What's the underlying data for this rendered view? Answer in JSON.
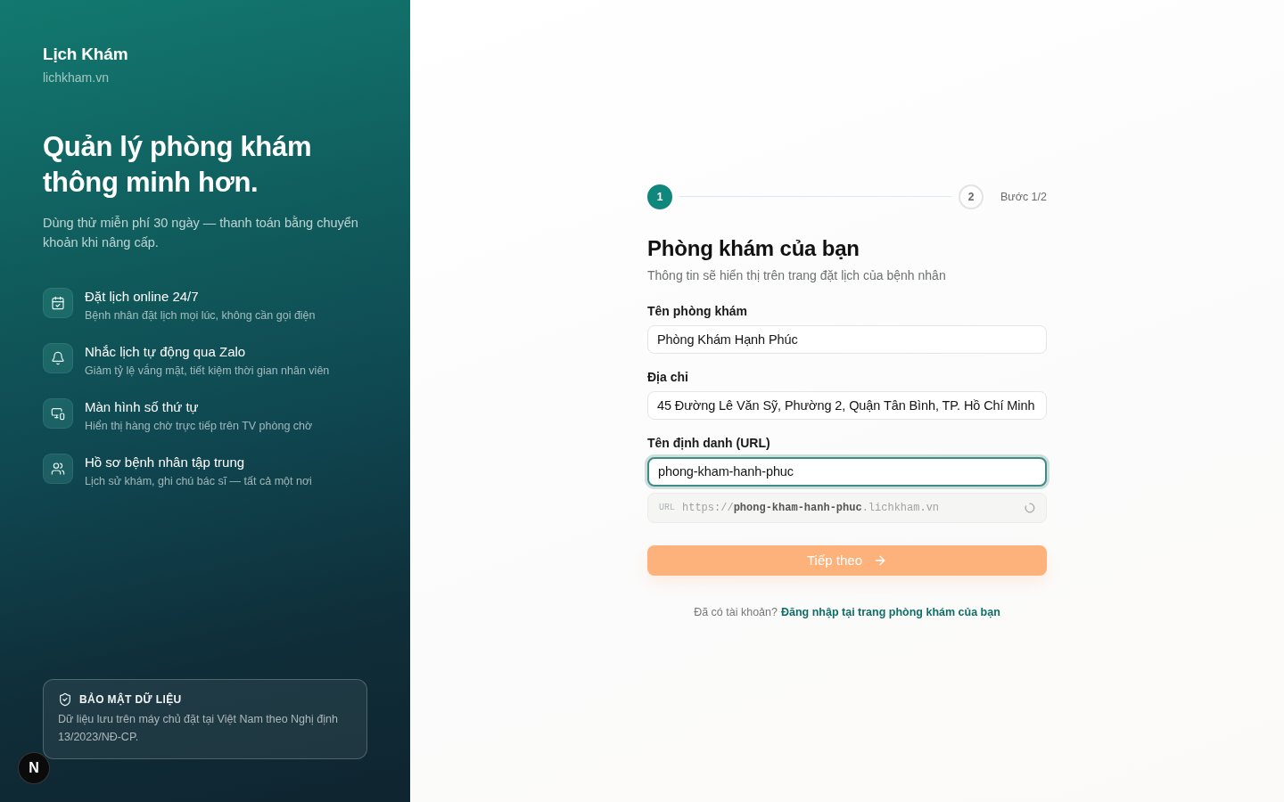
{
  "brand": {
    "name": "Lịch Khám",
    "domain": "lichkham.vn"
  },
  "hero": {
    "headline": "Quản lý phòng khám thông minh hơn.",
    "description": "Dùng thử miễn phí 30 ngày — thanh toán bằng chuyển khoản khi nâng cấp."
  },
  "features": [
    {
      "title": "Đặt lịch online 24/7",
      "description": "Bệnh nhân đặt lịch mọi lúc, không cần gọi điện"
    },
    {
      "title": "Nhắc lịch tự động qua Zalo",
      "description": "Giảm tỷ lệ vắng mặt, tiết kiệm thời gian nhân viên"
    },
    {
      "title": "Màn hình số thứ tự",
      "description": "Hiển thị hàng chờ trực tiếp trên TV phòng chờ"
    },
    {
      "title": "Hồ sơ bệnh nhân tập trung",
      "description": "Lịch sử khám, ghi chú bác sĩ — tất cả một nơi"
    }
  ],
  "security_note": {
    "title": "BẢO MẬT DỮ LIỆU",
    "text": "Dữ liệu lưu trên máy chủ đặt tại Việt Nam theo Nghị định 13/2023/NĐ-CP."
  },
  "dev_badge": {
    "label": "N"
  },
  "form": {
    "stepper": {
      "steps": [
        {
          "label": "1",
          "active": true
        },
        {
          "label": "2",
          "active": false
        }
      ],
      "step_count": "Bước 1/2"
    },
    "title": "Phòng khám của bạn",
    "subtitle": "Thông tin sẽ hiển thị trên trang đặt lịch của bệnh nhân",
    "fields": [
      {
        "label": "Tên phòng khám",
        "value": "Phòng Khám Hạnh Phúc",
        "focused": false
      },
      {
        "label": "Địa chỉ",
        "value": "45 Đường Lê Văn Sỹ, Phường 2, Quận Tân Bình, TP. Hồ Chí Minh",
        "focused": false
      },
      {
        "label": "Tên định danh (URL)",
        "value": "phong-kham-hanh-phuc",
        "focused": true
      }
    ],
    "url_preview": {
      "tag": "URL",
      "url": "https://**phong-kham-hanh-phuc**.lichkham.vn"
    },
    "submit": "Tiếp theo",
    "login_prompt": {
      "text": "Đã có tài khoản?",
      "link": "Đăng nhập tại trang phòng khám của bạn"
    }
  }
}
